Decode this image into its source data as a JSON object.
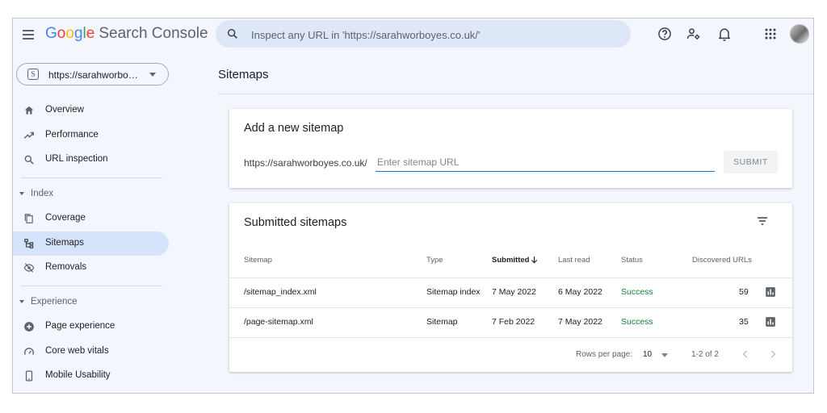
{
  "app": {
    "logo_letters": [
      "G",
      "o",
      "o",
      "g",
      "l",
      "e"
    ],
    "product_name": "Search Console"
  },
  "header": {
    "search_placeholder": "Inspect any URL in 'https://sarahworboyes.co.uk/'",
    "icons": [
      "help-icon",
      "manage-users-icon",
      "notifications-icon",
      "apps-grid-icon"
    ]
  },
  "sidebar": {
    "property": "https://sarahworbo…",
    "property_badge": "S",
    "items_top": [
      {
        "label": "Overview",
        "icon": "home-icon"
      },
      {
        "label": "Performance",
        "icon": "trending-up-icon"
      },
      {
        "label": "URL inspection",
        "icon": "search-icon"
      }
    ],
    "index_section": "Index",
    "items_index": [
      {
        "label": "Coverage",
        "icon": "copy-icon"
      },
      {
        "label": "Sitemaps",
        "icon": "sitemap-icon",
        "active": true
      },
      {
        "label": "Removals",
        "icon": "visibility-off-icon"
      }
    ],
    "experience_section": "Experience",
    "items_experience": [
      {
        "label": "Page experience",
        "icon": "add-circle-icon"
      },
      {
        "label": "Core web vitals",
        "icon": "speed-icon"
      },
      {
        "label": "Mobile Usability",
        "icon": "smartphone-icon"
      }
    ]
  },
  "main": {
    "page_title": "Sitemaps",
    "add_card": {
      "title": "Add a new sitemap",
      "url_prefix": "https://sarahworboyes.co.uk/",
      "input_placeholder": "Enter sitemap URL",
      "submit_label": "SUBMIT"
    },
    "submitted_card": {
      "title": "Submitted sitemaps",
      "columns": [
        "Sitemap",
        "Type",
        "Submitted",
        "Last read",
        "Status",
        "Discovered URLs"
      ],
      "sorted_column": "Submitted",
      "rows": [
        {
          "sitemap": "/sitemap_index.xml",
          "type": "Sitemap index",
          "submitted": "7 May 2022",
          "last_read": "6 May 2022",
          "status": "Success",
          "discovered": "59"
        },
        {
          "sitemap": "/page-sitemap.xml",
          "type": "Sitemap",
          "submitted": "7 Feb 2022",
          "last_read": "7 May 2022",
          "status": "Success",
          "discovered": "35"
        }
      ],
      "footer": {
        "rows_per_page_label": "Rows per page:",
        "rows_per_page_value": "10",
        "range": "1-2 of 2"
      }
    }
  },
  "colors": {
    "accent": "#1a73e8",
    "active_nav": "#d6e4fb",
    "success": "#188038",
    "background": "#f3f6fc"
  }
}
